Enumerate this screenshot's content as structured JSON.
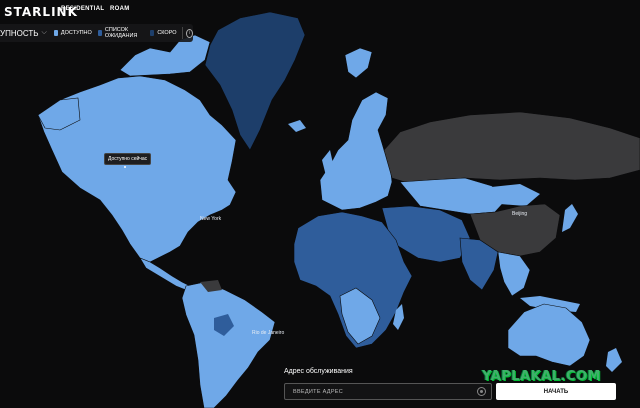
{
  "header": {
    "logo": "STARLINK",
    "nav": [
      "RESIDENTIAL",
      "ROAM"
    ]
  },
  "legend": {
    "title": "УПНОСТЬ",
    "items": [
      {
        "label": "ДОСТУПНО",
        "color": "#6fa8e8"
      },
      {
        "label": "СПИСОК ОЖИДАНИЯ",
        "color": "#2f5d9b"
      },
      {
        "label": "СКОРО",
        "color": "#1d3e6a"
      }
    ]
  },
  "tooltip": "Доступно сейчас",
  "map_labels": [
    "New York",
    "Rio de Janeiro",
    "Beijing"
  ],
  "address_panel": {
    "title": "Адрес обслуживания",
    "placeholder": "ВВЕДИТЕ АДРЕС",
    "button": "НАЧАТЬ"
  },
  "watermark": "YAPLAKAL.COM",
  "colors": {
    "available": "#6fa8e8",
    "waitlist": "#2f5d9b",
    "soon": "#1d3e6a",
    "unavailable": "#3a3a3c",
    "ocean": "#0b0b0c"
  }
}
